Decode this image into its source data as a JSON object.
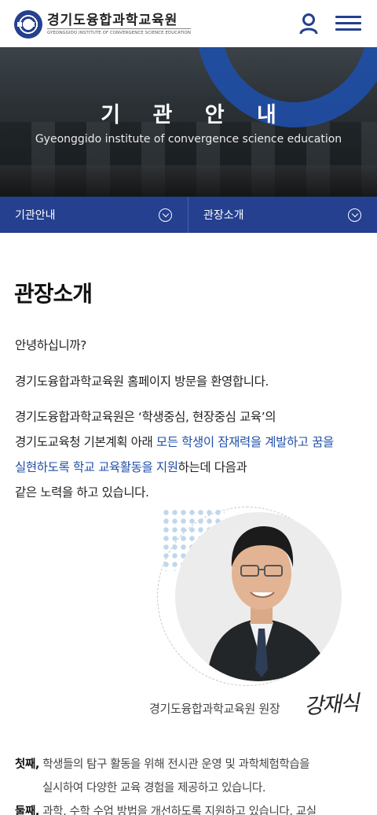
{
  "header": {
    "logo_title": "경기도융합과학교육원",
    "logo_subtitle": "GYEONGGIDO INSTITUTE OF CONVERGENCE SCIENCE EDUCATION",
    "accent_color": "#24408f"
  },
  "hero": {
    "title": "기 관 안 내",
    "subtitle": "Gyeonggido institute of convergence science education"
  },
  "subnav": {
    "first_label": "기관안내",
    "second_label": "관장소개"
  },
  "content": {
    "page_title": "관장소개",
    "greeting": "안녕하십니까?",
    "welcome": "경기도융합과학교육원 홈페이지 방문을 환영합니다.",
    "intro_line1": "경기도융합과학교육원은 ‘학생중심, 현장중심 교육’의",
    "intro_line2_a": "경기도교육청 기본계획 아래 ",
    "intro_line2_highlight": "모든 학생이 잠재력을 계발하고 꿈을",
    "intro_line3_highlight": "실현하도록 학교 교육활동을 지원",
    "intro_line3_b": "하는데 다음과",
    "intro_line4": "같은 노력을 하고 있습니다.",
    "caption": "경기도융합과학교육원 원장",
    "signature": "강재식",
    "list": [
      {
        "ordinal": "첫째,",
        "line1": " 학생들의 탐구 활동을 위해 전시관 운영 및 과학체험학습을",
        "line2": "실시하여 다양한 교육 경험을 제공하고 있습니다."
      },
      {
        "ordinal": "둘째,",
        "line1": " 과학, 수학 수업 방법을 개선하도록 지원하고 있습니다. 교실"
      }
    ]
  }
}
